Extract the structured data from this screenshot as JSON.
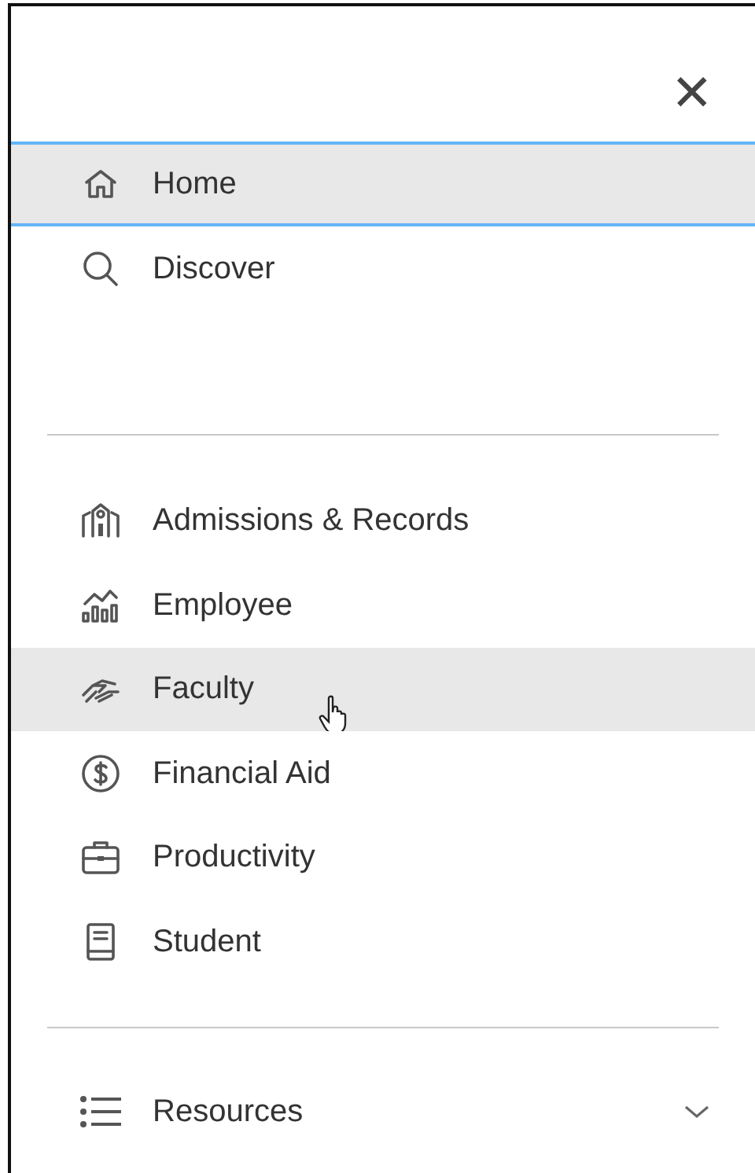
{
  "close_button": {
    "label": "✕"
  },
  "primary_items": [
    {
      "label": "Home",
      "selected": true,
      "hovered": false
    },
    {
      "label": "Discover",
      "selected": false,
      "hovered": false
    }
  ],
  "category_items": [
    {
      "label": "Admissions & Records",
      "selected": false,
      "hovered": false
    },
    {
      "label": "Employee",
      "selected": false,
      "hovered": false
    },
    {
      "label": "Faculty",
      "selected": false,
      "hovered": true
    },
    {
      "label": "Financial Aid",
      "selected": false,
      "hovered": false
    },
    {
      "label": "Productivity",
      "selected": false,
      "hovered": false
    },
    {
      "label": "Student",
      "selected": false,
      "hovered": false
    }
  ],
  "resources": {
    "label": "Resources",
    "expanded": false
  }
}
